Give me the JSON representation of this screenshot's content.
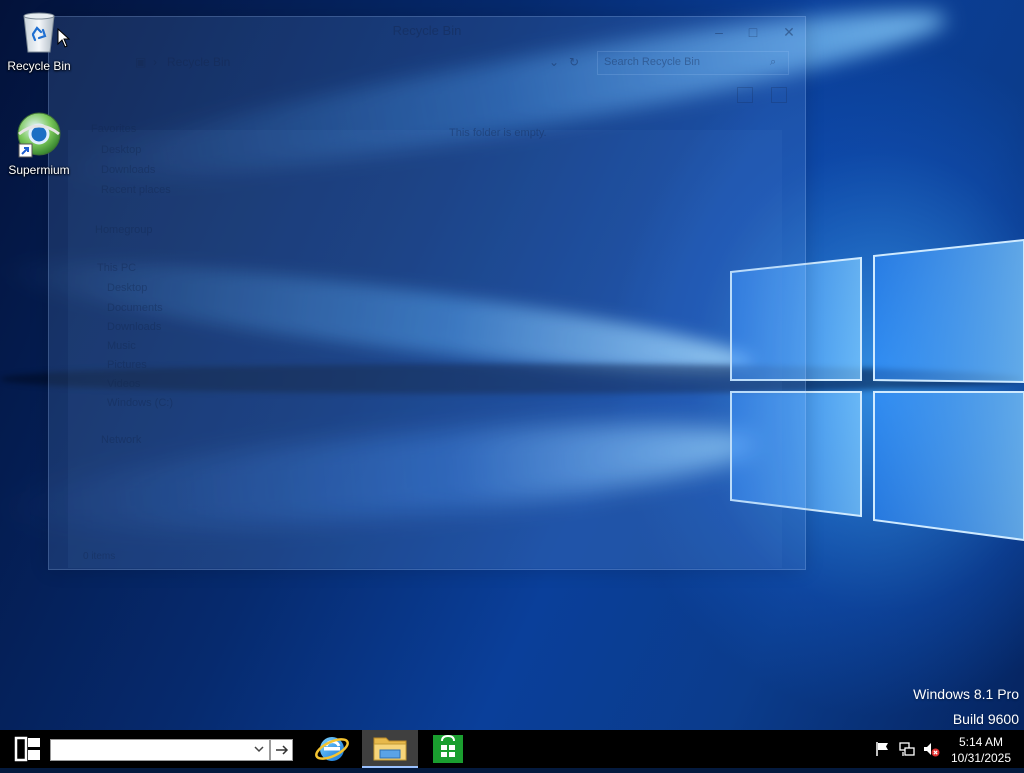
{
  "desktop": {
    "icons": [
      {
        "label": "Recycle Bin"
      },
      {
        "label": "Supermium"
      }
    ]
  },
  "explorer": {
    "title": "Recycle Bin",
    "address": "Recycle Bin",
    "search_placeholder": "Search Recycle Bin",
    "empty_text": "This folder is empty.",
    "status": "0 items",
    "nav": {
      "favorites": "Favorites",
      "fav_items": [
        "Desktop",
        "Downloads",
        "Recent places"
      ],
      "homegroup": "Homegroup",
      "this_pc": "This PC",
      "pc_items": [
        "Desktop",
        "Documents",
        "Downloads",
        "Music",
        "Pictures",
        "Videos",
        "Windows (C:)"
      ],
      "network": "Network"
    }
  },
  "watermark": {
    "line1": "Windows 8.1 Pro",
    "line2": "Build 9600"
  },
  "taskbar": {
    "search_value": "",
    "go_icon": "arrow-right-icon",
    "pinned": [
      {
        "name": "internet-explorer",
        "active": false
      },
      {
        "name": "file-explorer",
        "active": true
      },
      {
        "name": "windows-store",
        "active": false
      }
    ],
    "clock": {
      "time": "5:14 AM",
      "date": "10/31/2025"
    }
  },
  "colors": {
    "taskbar_bg": "#000000",
    "accent": "#1e90ff",
    "store_green": "#1a9e2f"
  }
}
